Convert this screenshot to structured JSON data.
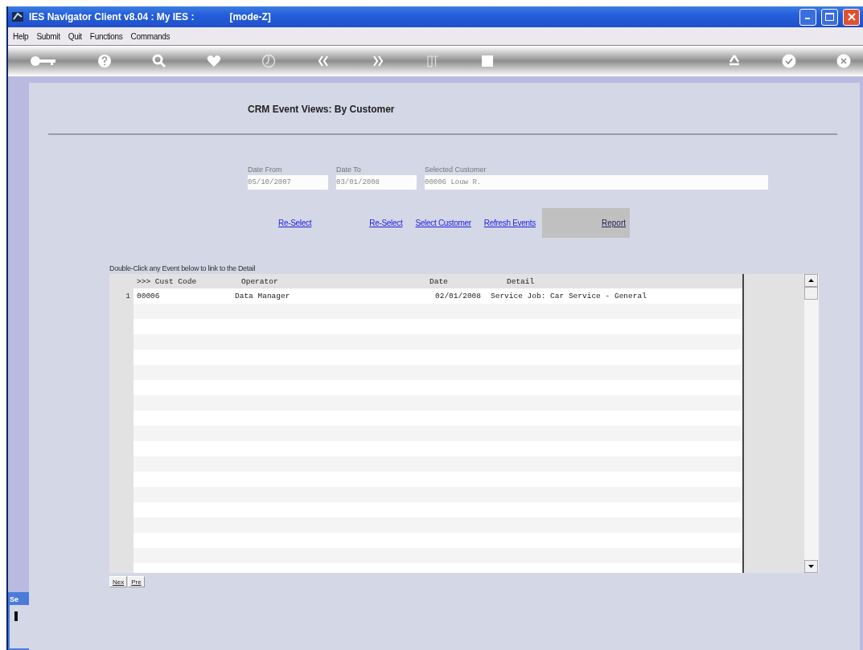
{
  "window": {
    "title": "IES Navigator Client v8.04 : My IES :",
    "mode": "[mode-Z]"
  },
  "menu": [
    "Help",
    "Submit",
    "Quit",
    "Functions",
    "Commands"
  ],
  "page_title": "CRM Event Views: By Customer",
  "fields": [
    {
      "label": "Date From",
      "value": "05/10/2007",
      "kind": "short"
    },
    {
      "label": "Date To",
      "value": "03/01/2008",
      "kind": "short"
    },
    {
      "label": "Selected Customer",
      "value": "00006 Louw R.",
      "kind": "wide"
    }
  ],
  "actions": [
    {
      "label": "Re-Select",
      "kind": "link"
    },
    {
      "label": "Re-Select",
      "kind": "link"
    },
    {
      "label": "Select Customer",
      "kind": "link"
    },
    {
      "label": "Refresh Events",
      "kind": "link"
    },
    {
      "label": "Report",
      "kind": "panel"
    }
  ],
  "hint": "Double-Click any Event below to link to the Detail",
  "table": {
    "columns": [
      ">>> Cust Code",
      "Operator",
      "Date",
      "Detail"
    ],
    "rows": [
      {
        "number": "1",
        "cells": [
          "00006",
          "Data Manager",
          "02/01/2008",
          "Service Job: Car Service - General"
        ]
      }
    ]
  },
  "pager": [
    "Nex",
    "Pre"
  ],
  "side_window": {
    "title": "Se"
  }
}
